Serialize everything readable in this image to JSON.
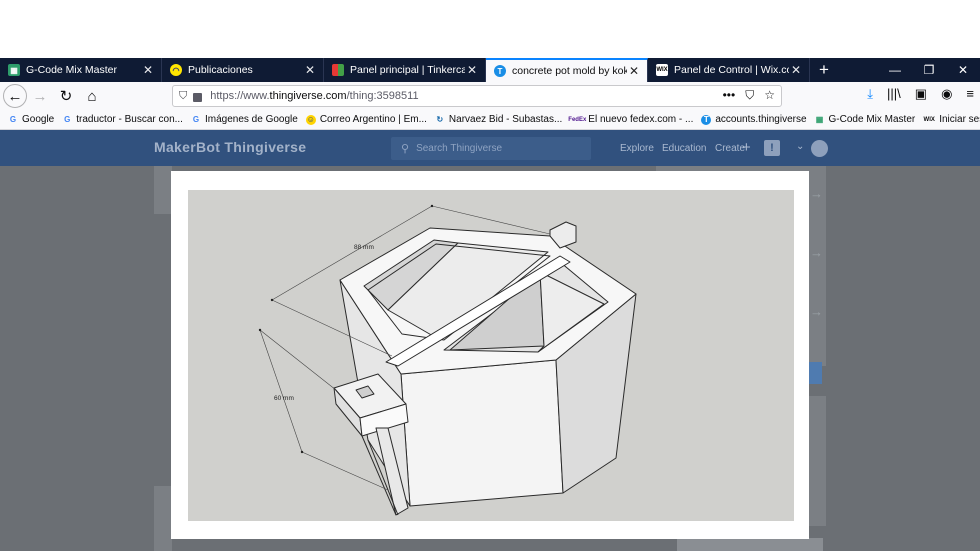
{
  "browser": {
    "tabs": [
      {
        "title": "G-Code Mix Master",
        "favicon": "gcode-icon",
        "active": false
      },
      {
        "title": "Publicaciones",
        "favicon": "mercadolibre-icon",
        "active": false
      },
      {
        "title": "Panel principal | Tinkercad",
        "favicon": "tinkercad-icon",
        "active": false
      },
      {
        "title": "concrete pot mold by kokaboq",
        "favicon": "thingiverse-icon",
        "active": true
      },
      {
        "title": "Panel de Control | Wix.com",
        "favicon": "wix-icon",
        "active": false
      }
    ],
    "new_tab_symbol": "+",
    "window_controls": {
      "minimize": "—",
      "restore": "❐",
      "close": "✕"
    },
    "url_prefix": "https://www.",
    "url_domain": "thingiverse.com",
    "url_path": "/thing:3598511",
    "url_actions": {
      "more": "•••",
      "pocket": "⛉",
      "star": "☆"
    },
    "toolbar_icons": {
      "download": "⤓",
      "library": "|||\\",
      "sidebar": "▣",
      "account": "◉",
      "menu": "≡"
    },
    "bookmarks": [
      {
        "label": "Google",
        "favicon": "google-icon"
      },
      {
        "label": "traductor - Buscar con...",
        "favicon": "google-icon"
      },
      {
        "label": "Imágenes de Google",
        "favicon": "google-icon"
      },
      {
        "label": "Correo Argentino | Em...",
        "favicon": "correo-icon"
      },
      {
        "label": "Narvaez Bid - Subastas...",
        "favicon": "narvaez-icon"
      },
      {
        "label": "El nuevo fedex.com - ...",
        "favicon": "fedex-icon"
      },
      {
        "label": "accounts.thingiverse",
        "favicon": "thingiverse-icon"
      },
      {
        "label": "G-Code Mix Master",
        "favicon": "gcode-icon"
      },
      {
        "label": "Iniciar sesión | Wix",
        "favicon": "wix-icon"
      }
    ]
  },
  "site": {
    "logo_brand": "MakerBot",
    "logo_product": "Thingiverse",
    "search_placeholder": "Search Thingiverse",
    "nav": {
      "explore": "Explore",
      "education": "Education",
      "create": "Create",
      "create_plus": "+"
    },
    "alert_badge": "!"
  },
  "modal": {
    "dimension_width": "88 mm",
    "dimension_height": "60 mm"
  },
  "colors": {
    "tab_strip": "#0f1b34",
    "active_tab_accent": "#0a84ff",
    "site_header": "#31517e",
    "overlay": "#6b6f74",
    "viewer_bg": "#d0d0cd"
  }
}
